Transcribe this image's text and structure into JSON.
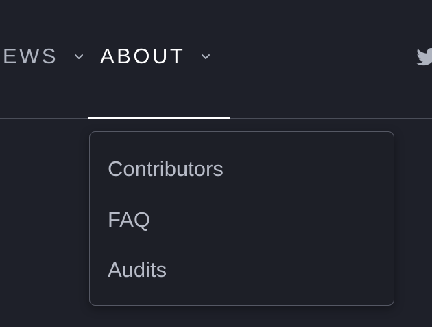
{
  "nav": {
    "items": [
      {
        "label": "NEWS"
      },
      {
        "label": "ABOUT"
      }
    ],
    "active_item": "ABOUT",
    "social_icon": "twitter-icon"
  },
  "dropdown": {
    "items": [
      {
        "label": "Contributors"
      },
      {
        "label": "FAQ"
      },
      {
        "label": "Audits"
      }
    ]
  },
  "colors": {
    "background": "#1e2029",
    "active_text": "#ffffff",
    "inactive_text": "#aeb3bf",
    "border": "#555864"
  }
}
